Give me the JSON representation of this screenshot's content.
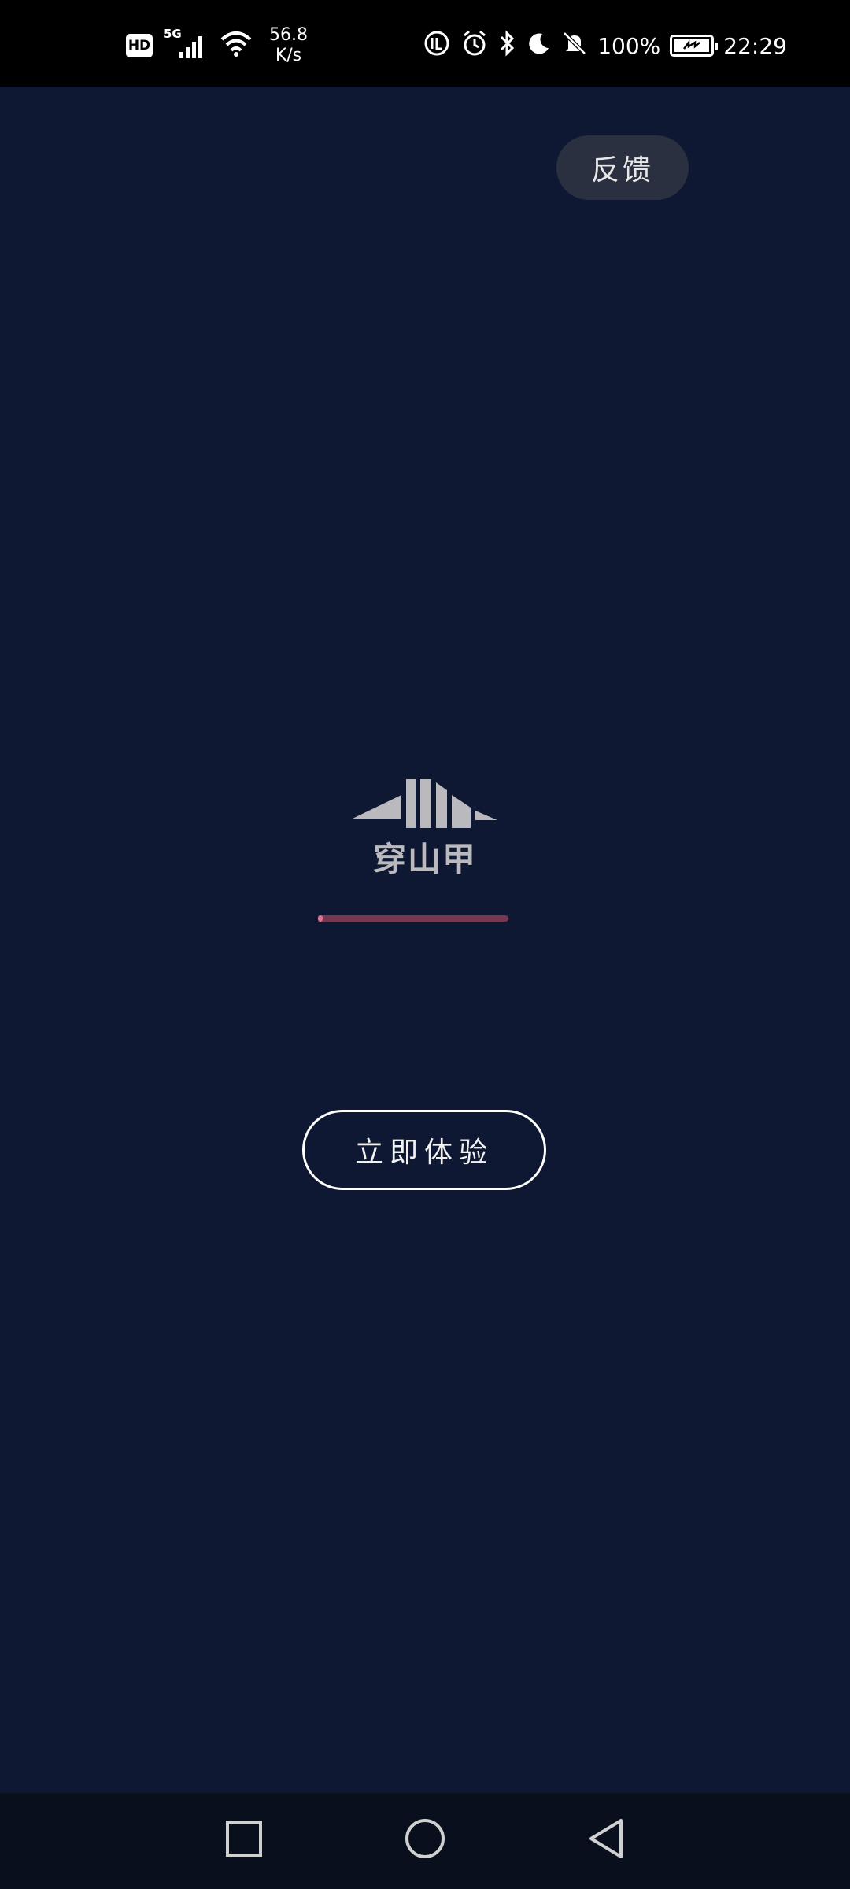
{
  "status_bar": {
    "hd": "HD",
    "network_type": "5G",
    "speed_value": "56.8",
    "speed_unit": "K/s",
    "battery": "100%",
    "time": "22:29"
  },
  "feedback_label": "反馈",
  "logo_text": "穿山甲",
  "progress": {
    "value_percent": 2,
    "fill_color": "#e0708f",
    "track_color": "#7a3550"
  },
  "try_now_label": "立即体验",
  "colors": {
    "background": "#0f1833",
    "status_bar": "#000000",
    "nav_bar": "#0a0f1e"
  },
  "nav": {
    "recent_icon": "square-icon",
    "home_icon": "circle-icon",
    "back_icon": "triangle-back-icon"
  }
}
